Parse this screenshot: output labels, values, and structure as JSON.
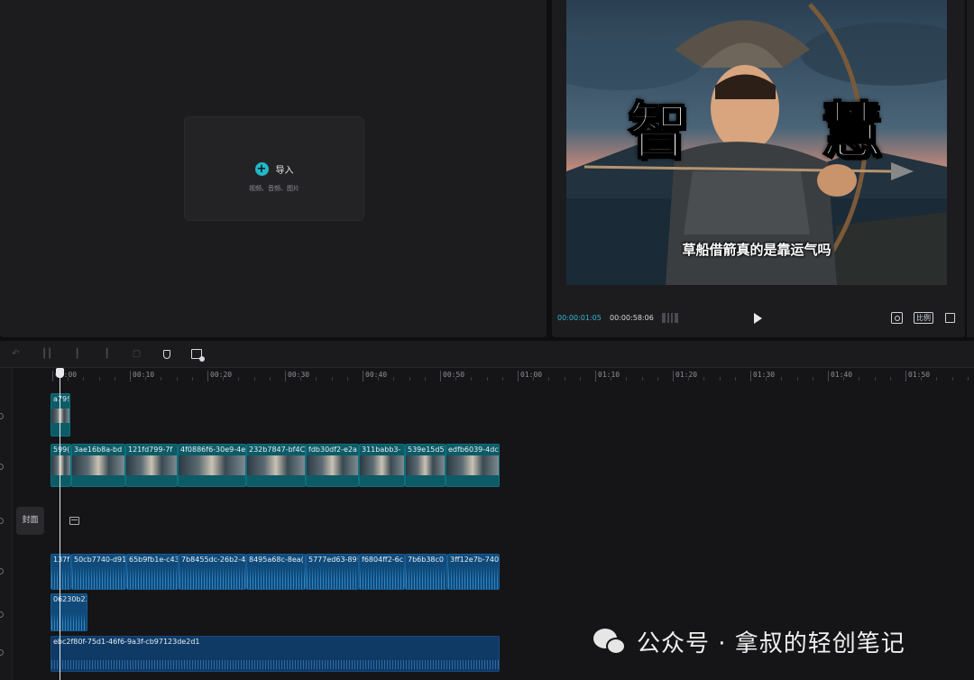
{
  "media": {
    "import_label": "导入",
    "import_sub": "视频、音频、图片"
  },
  "preview": {
    "caption_left": "智",
    "caption_right": "慧",
    "subtitle": "草船借箭真的是靠运气吗"
  },
  "player": {
    "current_time": "00:00:01:05",
    "total_time": "00:00:58:06",
    "ratio_label": "比例"
  },
  "ruler": {
    "labels": [
      "00:00",
      "00:10",
      "00:20",
      "00:30",
      "00:40",
      "00:50",
      "01:00",
      "01:10",
      "01:20",
      "01:30",
      "01:40",
      "01:50"
    ]
  },
  "tracks": {
    "cover_label": "封面",
    "overlay_clip": "a79!",
    "video_clips": [
      "599(",
      "3ae16b8a-bd",
      "121fd799-7f",
      "4f0886f6-30e9-4e",
      "232b7847-bf4C",
      "fdb30df2-e2a",
      "311babb3-",
      "539e15d5",
      "edfb6039-4dc"
    ],
    "voice_clips": [
      "137f",
      "50cb7740-d91",
      "65b9fb1e-c43",
      "7b8455dc-26b2-4",
      "8495a68c-8ea(",
      "5777ed63-89!",
      "f6804ff2-6c",
      "7b6b38c0",
      "3ff12e7b-740a"
    ],
    "sfx_clip": "06230b23",
    "music_clip": "ebc2f80f-75d1-46f6-9a3f-cb97123de2d1"
  },
  "watermark": {
    "text": "公众号 · 拿叔的轻创笔记"
  },
  "colors": {
    "accent": "#21b7c8",
    "timecode": "#35b8d0",
    "video_clip": "#0c5b66",
    "audio_clip": "#0f4a7a"
  }
}
